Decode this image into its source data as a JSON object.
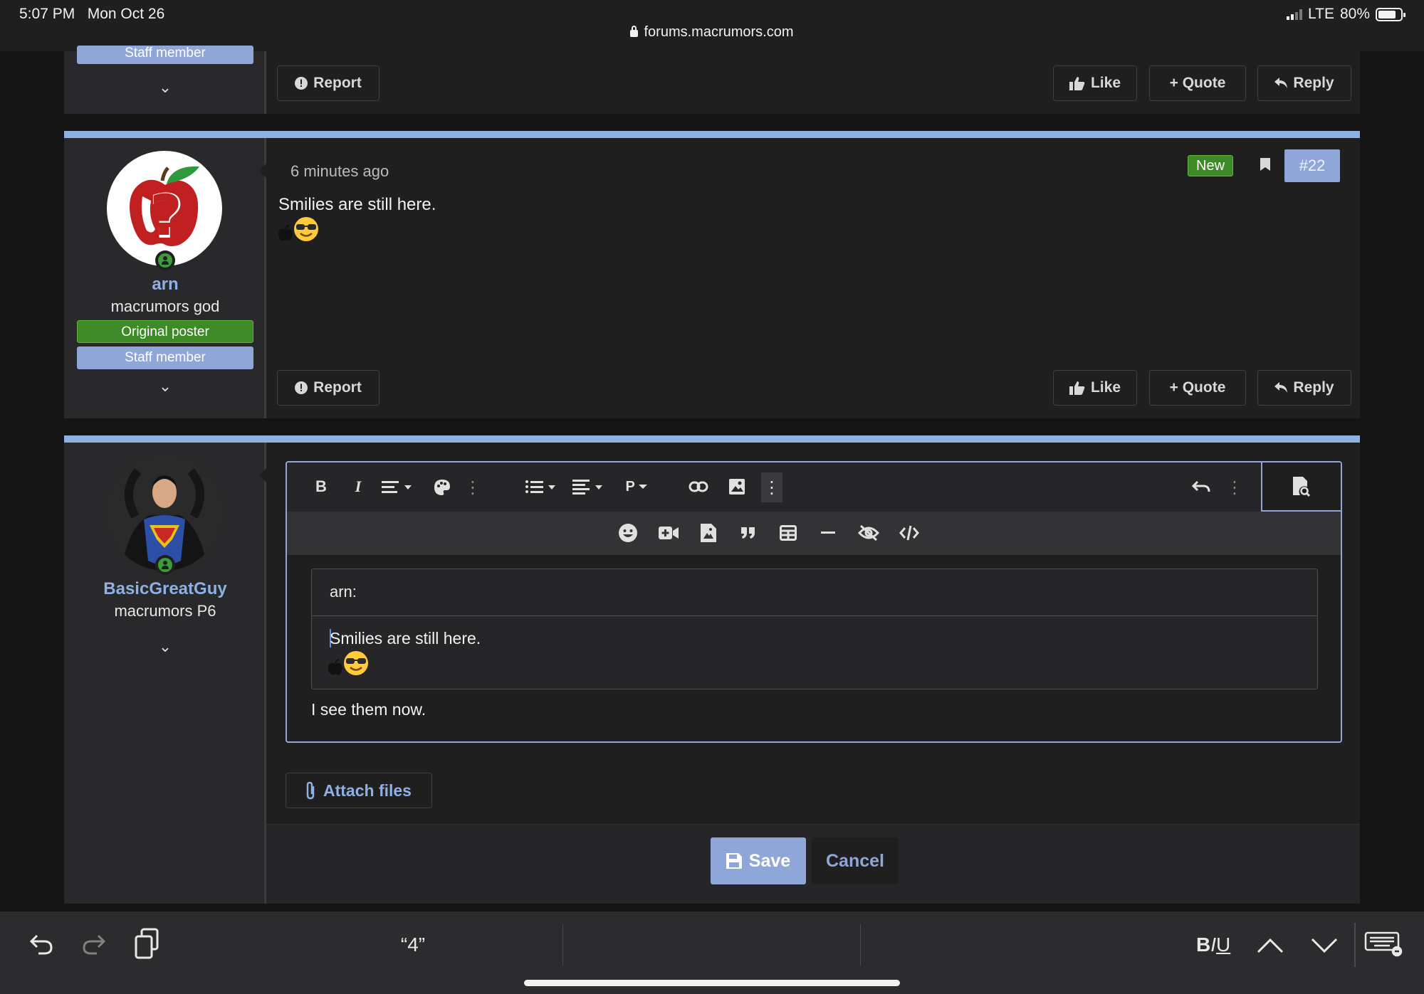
{
  "status_bar": {
    "time": "5:07 PM",
    "date": "Mon Oct 26",
    "network": "LTE",
    "battery": "80%",
    "battery_level": 0.8,
    "url": "forums.macrumors.com"
  },
  "top_post": {
    "badge": "Staff member",
    "actions": {
      "report": "Report",
      "like": "Like",
      "quote": "+ Quote",
      "reply": "Reply"
    }
  },
  "post": {
    "username": "arn",
    "user_title": "macrumors god",
    "badges": {
      "original_poster": "Original poster",
      "staff": "Staff member"
    },
    "time": "6 minutes ago",
    "new_label": "New",
    "post_number": "#22",
    "message": "Smilies are still here.",
    "actions": {
      "report": "Report",
      "like": "Like",
      "quote": "+ Quote",
      "reply": "Reply"
    }
  },
  "editor": {
    "username": "BasicGreatGuy",
    "user_title": "macrumors P6",
    "quote_author": "arn:",
    "quote_text": "Smilies are still here.",
    "reply_text": "I see them now.",
    "attach_label": "Attach files",
    "save_label": "Save",
    "cancel_label": "Cancel",
    "toolbar": [
      "bold-icon",
      "italic-icon",
      "text-style-icon",
      "palette-icon",
      "more-icon",
      "list-icon",
      "align-icon",
      "paragraph-icon",
      "link-icon",
      "image-icon",
      "more-icon",
      "undo-icon",
      "more-icon",
      "preview-icon",
      "smilie-icon",
      "video-icon",
      "media-icon",
      "quote-icon",
      "table-icon",
      "horizontal-line-icon",
      "spoiler-icon",
      "code-icon"
    ],
    "paragraph_label": "P"
  },
  "keyboard_bar": {
    "suggestion": "“4”",
    "format_bold": "B",
    "format_italic": "I",
    "format_underline": "U"
  },
  "colors": {
    "accent": "#8fb0e3",
    "badge_blue": "#8fa6d8",
    "badge_green": "#3d8a26",
    "background": "#141415"
  }
}
